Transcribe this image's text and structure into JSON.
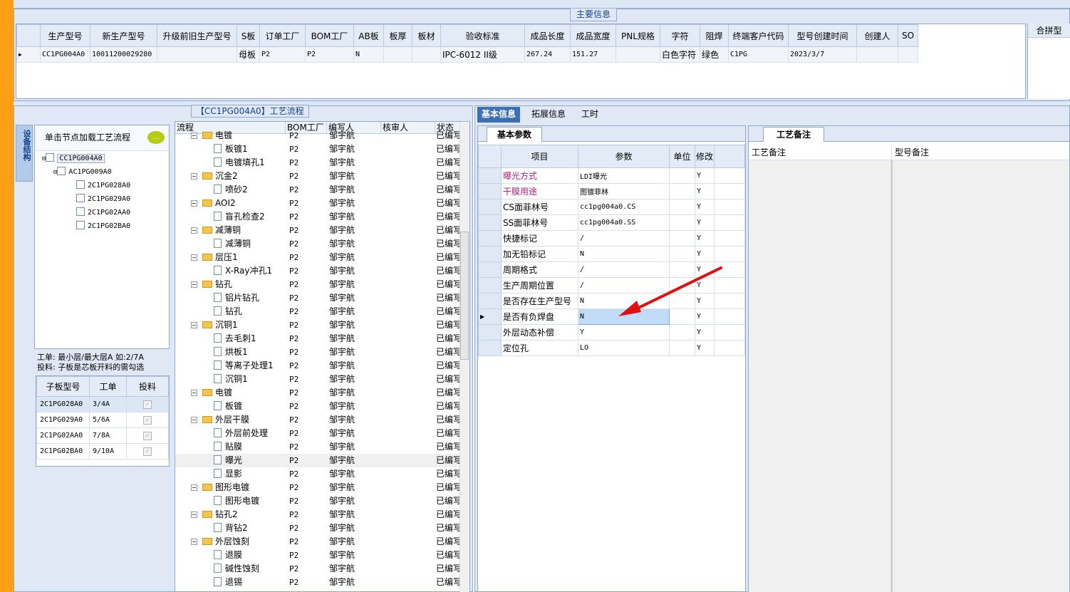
{
  "main_title": "主要信息",
  "main_grid": {
    "columns": [
      "生产型号",
      "新生产型号",
      "升级前旧生产型号",
      "S板",
      "订单工厂",
      "BOM工厂",
      "AB板",
      "板厚",
      "板材",
      "验收标准",
      "成品长度",
      "成品宽度",
      "PNL规格",
      "字符",
      "阻焊",
      "终端客户代码",
      "型号创建时间",
      "创建人",
      "SO"
    ],
    "row": [
      "CC1PG004A0",
      "10011200029280",
      "",
      "母板",
      "P2",
      "P2",
      "N",
      "",
      "",
      "IPC-6012 II级",
      "267.24",
      "151.27",
      "",
      "白色字符",
      "绿色",
      "C1PG",
      "2023/3/7",
      "",
      ""
    ]
  },
  "side_header": "合拼型",
  "flow_title": "【CC1PG004A0】工艺流程",
  "vertical_tab": "设备结构",
  "tree": {
    "hint": "单击节点加载工艺流程",
    "nodes": [
      "CC1PG004A0",
      "AC1PG009A0",
      "2C1PG028A0",
      "2C1PG029A0",
      "2C1PG02AA0",
      "2C1PG02BA0"
    ]
  },
  "notes": {
    "line1": "工单: 最小层/最大层A 如:2/7A",
    "line2": "投料: 子板是芯板开料的需勾选"
  },
  "sub_grid": {
    "columns": [
      "子板型号",
      "工单",
      "投料"
    ],
    "rows": [
      [
        "2C1PG028A0",
        "3/4A"
      ],
      [
        "2C1PG029A0",
        "5/6A"
      ],
      [
        "2C1PG02AA0",
        "7/8A"
      ],
      [
        "2C1PG02BA0",
        "9/10A"
      ]
    ]
  },
  "flow_grid": {
    "columns": [
      "流程",
      "BOM工厂",
      "编写人",
      "核审人",
      "状态"
    ],
    "rows": [
      {
        "name": "电镀",
        "type": "folder",
        "factory": "P2",
        "writer": "邹宇航",
        "status": "已编写"
      },
      {
        "name": "板镀1",
        "type": "doc",
        "factory": "P2",
        "writer": "邹宇航",
        "status": "已编写"
      },
      {
        "name": "电镀填孔1",
        "type": "doc",
        "factory": "P2",
        "writer": "邹宇航",
        "status": "已编写"
      },
      {
        "name": "沉金2",
        "type": "folder",
        "factory": "P2",
        "writer": "邹宇航",
        "status": "已编写"
      },
      {
        "name": "喷砂2",
        "type": "doc",
        "factory": "P2",
        "writer": "邹宇航",
        "status": "已编写"
      },
      {
        "name": "AOI2",
        "type": "folder",
        "factory": "P2",
        "writer": "邹宇航",
        "status": "已编写"
      },
      {
        "name": "盲孔检查2",
        "type": "doc",
        "factory": "P2",
        "writer": "邹宇航",
        "status": "已编写"
      },
      {
        "name": "减薄铜",
        "type": "folder",
        "factory": "P2",
        "writer": "邹宇航",
        "status": "已编写"
      },
      {
        "name": "减薄铜",
        "type": "doc",
        "factory": "P2",
        "writer": "邹宇航",
        "status": "已编写"
      },
      {
        "name": "层压1",
        "type": "folder",
        "factory": "P2",
        "writer": "邹宇航",
        "status": "已编写"
      },
      {
        "name": "X-Ray冲孔1",
        "type": "doc",
        "factory": "P2",
        "writer": "邹宇航",
        "status": "已编写"
      },
      {
        "name": "钻孔",
        "type": "folder",
        "factory": "P2",
        "writer": "邹宇航",
        "status": "已编写"
      },
      {
        "name": "铝片钻孔",
        "type": "doc",
        "factory": "P2",
        "writer": "邹宇航",
        "status": "已编写"
      },
      {
        "name": "钻孔",
        "type": "doc",
        "factory": "P2",
        "writer": "邹宇航",
        "status": "已编写"
      },
      {
        "name": "沉铜1",
        "type": "folder",
        "factory": "P2",
        "writer": "邹宇航",
        "status": "已编写"
      },
      {
        "name": "去毛刺1",
        "type": "doc",
        "factory": "P2",
        "writer": "邹宇航",
        "status": "已编写"
      },
      {
        "name": "烘板1",
        "type": "doc",
        "factory": "P2",
        "writer": "邹宇航",
        "status": "已编写"
      },
      {
        "name": "等离子处理1",
        "type": "doc",
        "factory": "P2",
        "writer": "邹宇航",
        "status": "已编写"
      },
      {
        "name": "沉铜1",
        "type": "doc",
        "factory": "P2",
        "writer": "邹宇航",
        "status": "已编写"
      },
      {
        "name": "电镀",
        "type": "folder",
        "factory": "P2",
        "writer": "邹宇航",
        "status": "已编写"
      },
      {
        "name": "板镀",
        "type": "doc",
        "factory": "P2",
        "writer": "邹宇航",
        "status": "已编写"
      },
      {
        "name": "外层干膜",
        "type": "folder",
        "factory": "P2",
        "writer": "邹宇航",
        "status": "已编写"
      },
      {
        "name": "外层前处理",
        "type": "doc",
        "factory": "P2",
        "writer": "邹宇航",
        "status": "已编写"
      },
      {
        "name": "贴膜",
        "type": "doc",
        "factory": "P2",
        "writer": "邹宇航",
        "status": "已编写"
      },
      {
        "name": "曝光",
        "type": "doc",
        "factory": "P2",
        "writer": "邹宇航",
        "status": "已编写"
      },
      {
        "name": "显影",
        "type": "doc",
        "factory": "P2",
        "writer": "邹宇航",
        "status": "已编写"
      },
      {
        "name": "图形电镀",
        "type": "folder",
        "factory": "P2",
        "writer": "邹宇航",
        "status": "已编写"
      },
      {
        "name": "图形电镀",
        "type": "doc",
        "factory": "P2",
        "writer": "邹宇航",
        "status": "已编写"
      },
      {
        "name": "钻孔2",
        "type": "folder",
        "factory": "P2",
        "writer": "邹宇航",
        "status": "已编写"
      },
      {
        "name": "背钻2",
        "type": "doc",
        "factory": "P2",
        "writer": "邹宇航",
        "status": "已编写"
      },
      {
        "name": "外层蚀刻",
        "type": "folder",
        "factory": "P2",
        "writer": "邹宇航",
        "status": "已编写"
      },
      {
        "name": "退膜",
        "type": "doc",
        "factory": "P2",
        "writer": "邹宇航",
        "status": "已编写"
      },
      {
        "name": "碱性蚀刻",
        "type": "doc",
        "factory": "P2",
        "writer": "邹宇航",
        "status": "已编写"
      },
      {
        "name": "退锡",
        "type": "doc",
        "factory": "P2",
        "writer": "邹宇航",
        "status": "已编写"
      }
    ]
  },
  "right_tabs": [
    "基本信息",
    "拓展信息",
    "工时"
  ],
  "basic_panel": {
    "tab": "基本参数",
    "columns": [
      "项目",
      "参数",
      "单位",
      "修改"
    ],
    "rows": [
      {
        "item": "曝光方式",
        "value": "LDI曝光",
        "mod": "Y"
      },
      {
        "item": "干膜用途",
        "value": "图镀菲林",
        "mod": "Y"
      },
      {
        "item": "CS面菲林号",
        "value": "cc1pg004a0.CS",
        "mod": "Y"
      },
      {
        "item": "SS面菲林号",
        "value": "cc1pg004a0.SS",
        "mod": "Y"
      },
      {
        "item": "快捷标记",
        "value": "/",
        "mod": "Y"
      },
      {
        "item": "加无铅标记",
        "value": "N",
        "mod": "Y"
      },
      {
        "item": "周期格式",
        "value": "/",
        "mod": "Y"
      },
      {
        "item": "生产周期位置",
        "value": "/",
        "mod": "Y"
      },
      {
        "item": "是否存在生产型号",
        "value": "N",
        "mod": "Y"
      },
      {
        "item": "是否有负焊盘",
        "value": "N",
        "mod": "Y"
      },
      {
        "item": "外层动态补偿",
        "value": "Y",
        "mod": "Y"
      },
      {
        "item": "定位孔",
        "value": "LO",
        "mod": "Y"
      }
    ]
  },
  "notes_panel": {
    "tab": "工艺备注",
    "col1": "工艺备注",
    "col2": "型号备注"
  },
  "colors": {
    "accent": "#3c6fb1",
    "arrow": "#e01010",
    "left_bar": "#ff9f16"
  }
}
